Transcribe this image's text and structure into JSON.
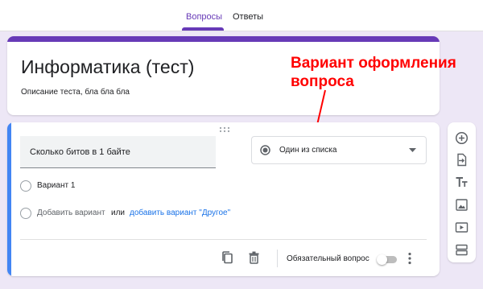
{
  "tabs": [
    {
      "label": "Вопросы",
      "active": true
    },
    {
      "label": "Ответы",
      "active": false
    }
  ],
  "form": {
    "title": "Информатика (тест)",
    "description": "Описание теста, бла бла бла",
    "theme_color": "#673ab7"
  },
  "annotation": {
    "line1": "Вариант оформления",
    "line2": "вопроса",
    "color": "#ff0000"
  },
  "question": {
    "text": "Сколько битов в 1 байте",
    "type": "Один из списка",
    "options": [
      {
        "label": "Вариант 1"
      }
    ],
    "add_option": "Добавить вариант",
    "or_text": "или",
    "add_other": "добавить вариант \"Другое\"",
    "required_label": "Обязательный вопрос",
    "required": false,
    "accent_color": "#4285f4"
  },
  "footer_icons": [
    "copy-icon",
    "trash-icon",
    "more-vert-icon"
  ],
  "sidebar_icons": [
    "add-circle-icon",
    "import-icon",
    "title-icon",
    "image-icon",
    "video-icon",
    "section-icon"
  ]
}
